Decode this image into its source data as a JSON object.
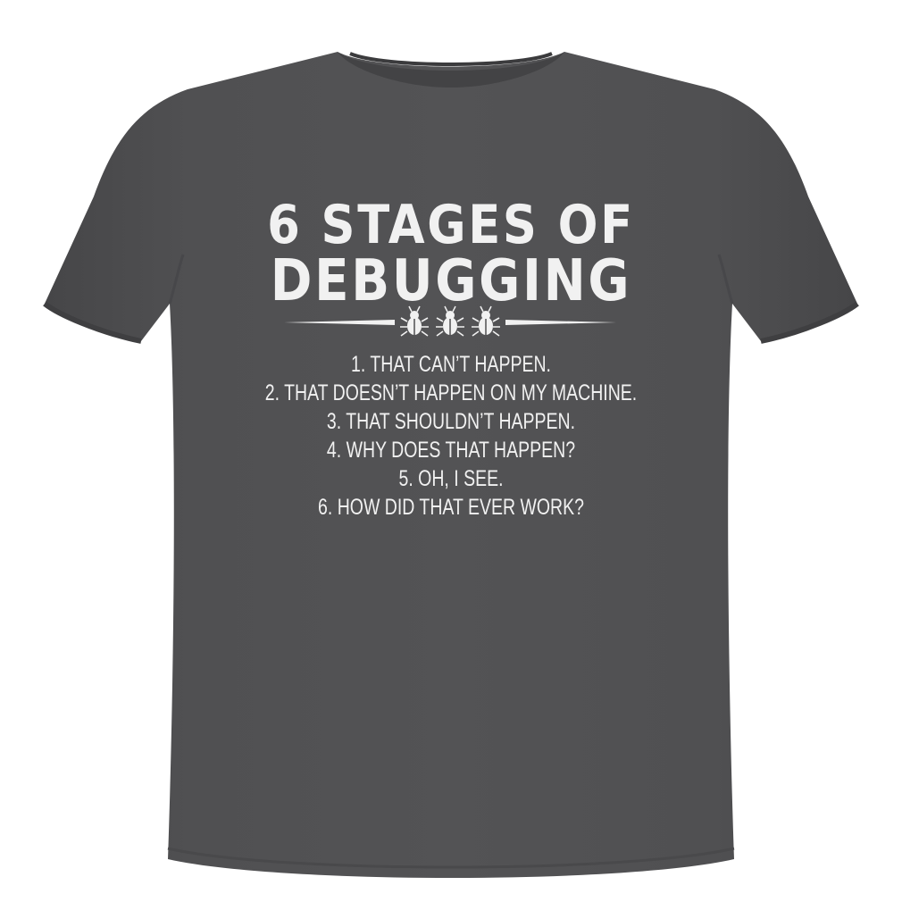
{
  "colors": {
    "background": "#ffffff",
    "shirt": "#4f4f51",
    "shirt_shadow": "#434345",
    "print": "#f1f1f1"
  },
  "print": {
    "title_line_1": "6 STAGES OF",
    "title_line_2": "DEBUGGING",
    "divider_icons": [
      "bug-icon",
      "bug-icon",
      "bug-icon"
    ],
    "stages": [
      "1. THAT CAN’T HAPPEN.",
      "2. THAT DOESN’T HAPPEN ON MY MACHINE.",
      "3. THAT SHOULDN’T HAPPEN.",
      "4. WHY DOES THAT HAPPEN?",
      "5. OH, I SEE.",
      "6. HOW DID THAT EVER WORK?"
    ]
  }
}
